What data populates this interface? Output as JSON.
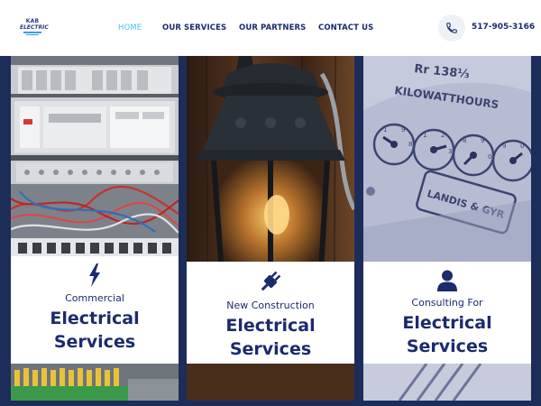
{
  "logo": {
    "line1": "KAB",
    "line2": "ELECTRIC"
  },
  "nav": {
    "items": [
      {
        "label": "HOME",
        "active": true
      },
      {
        "label": "OUR SERVICES",
        "active": false
      },
      {
        "label": "OUR PARTNERS",
        "active": false
      },
      {
        "label": "CONTACT US",
        "active": false
      }
    ]
  },
  "phone": {
    "icon": "phone-icon",
    "number": "517-905-3166"
  },
  "panels": [
    {
      "icon": "lightning-bolt-icon",
      "subtitle": "Commercial",
      "title_line1": "Electrical",
      "title_line2": "Services",
      "photo": "electrical panel breakers"
    },
    {
      "icon": "plug-icon",
      "subtitle": "New Construction",
      "title_line1": "Electrical",
      "title_line2": "Services",
      "photo": "vintage lantern lamp"
    },
    {
      "icon": "user-icon",
      "subtitle": "Consulting For",
      "title_line1": "Electrical",
      "title_line2": "Services",
      "photo": "kilowatt hour meter",
      "meter_text": [
        "Rr 138⅓",
        "KILOWATTHOURS",
        "LANDIS & GYR"
      ]
    }
  ],
  "colors": {
    "navy": "#1c2a6e",
    "accent": "#47c4e6",
    "hero_bg": "#1d2d5a"
  }
}
